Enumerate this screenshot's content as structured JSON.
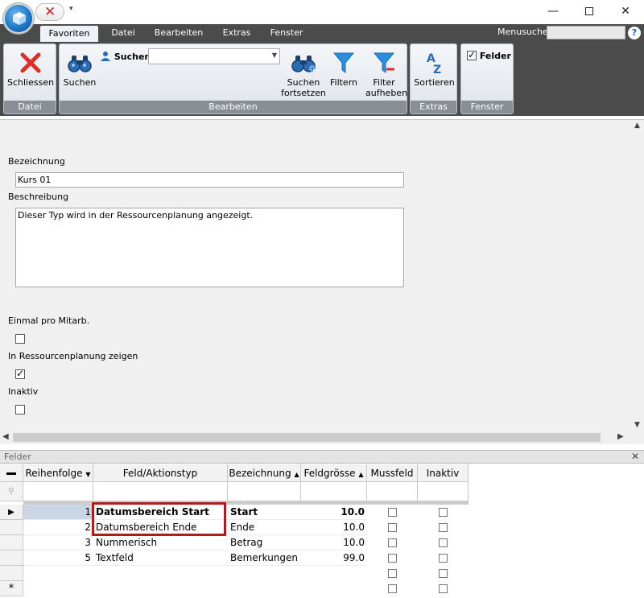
{
  "quick_access": {
    "close_symbol": "✕",
    "dropdown_symbol": "▾"
  },
  "window_controls": {
    "minimize": "—",
    "close": "✕"
  },
  "tabs": [
    "Favoriten",
    "Datei",
    "Bearbeiten",
    "Extras",
    "Fenster"
  ],
  "active_tab": "Favoriten",
  "menusuche": {
    "label": "Menusuche",
    "value": "",
    "help": "?"
  },
  "ribbon": {
    "groups": {
      "datei": {
        "caption": "Datei",
        "schliessen": "Schliessen"
      },
      "bearbeiten": {
        "caption": "Bearbeiten",
        "suchen": "Suchen",
        "suchen_small": "Suchen",
        "search_value": "",
        "suchen_fortsetzen_1": "Suchen",
        "suchen_fortsetzen_2": "fortsetzen",
        "filtern": "Filtern",
        "filter_aufheben_1": "Filter",
        "filter_aufheben_2": "aufheben"
      },
      "extras": {
        "caption": "Extras",
        "sortieren": "Sortieren"
      },
      "fenster": {
        "caption": "Fenster",
        "felder": "Felder",
        "felder_checked": true
      }
    },
    "colors": {
      "close_icon": "#d9302b",
      "binoculars": "#2a6db5",
      "funnel": "#2b8fe0"
    }
  },
  "form": {
    "bezeichnung_label": "Bezeichnung",
    "bezeichnung_value": "Kurs 01",
    "beschreibung_label": "Beschreibung",
    "beschreibung_value": "Dieser Typ wird in der Ressourcenplanung angezeigt.",
    "einmal_label": "Einmal pro Mitarb.",
    "einmal_checked": false,
    "ressourcen_label": "In Ressourcenplanung zeigen",
    "ressourcen_checked": true,
    "inaktiv_label": "Inaktiv",
    "inaktiv_checked": false
  },
  "felder_panel": {
    "title": "Felder",
    "close": "✕",
    "columns": [
      {
        "label": "Reihenfolge",
        "sort": "▼"
      },
      {
        "label": "Feld/Aktionstyp",
        "sort": ""
      },
      {
        "label": "Bezeichnung",
        "sort": "▲"
      },
      {
        "label": "Feldgrösse",
        "sort": "▲"
      },
      {
        "label": "Mussfeld",
        "sort": ""
      },
      {
        "label": "Inaktiv",
        "sort": ""
      }
    ],
    "new_row_marker": "*",
    "current_row_marker": "▶",
    "rows": [
      {
        "reihenfolge": "1",
        "feld": "Datumsbereich Start",
        "bezeichnung": "Start",
        "feldgroesse": "10.0",
        "muss": false,
        "inaktiv": false
      },
      {
        "reihenfolge": "2",
        "feld": "Datumsbereich Ende",
        "bezeichnung": "Ende",
        "feldgroesse": "10.0",
        "muss": false,
        "inaktiv": false
      },
      {
        "reihenfolge": "3",
        "feld": "Nummerisch",
        "bezeichnung": "Betrag",
        "feldgroesse": "10.0",
        "muss": false,
        "inaktiv": false
      },
      {
        "reihenfolge": "5",
        "feld": "Textfeld",
        "bezeichnung": "Bemerkungen",
        "feldgroesse": "99.0",
        "muss": false,
        "inaktiv": false
      }
    ],
    "highlight_color": "#b01c1c"
  }
}
